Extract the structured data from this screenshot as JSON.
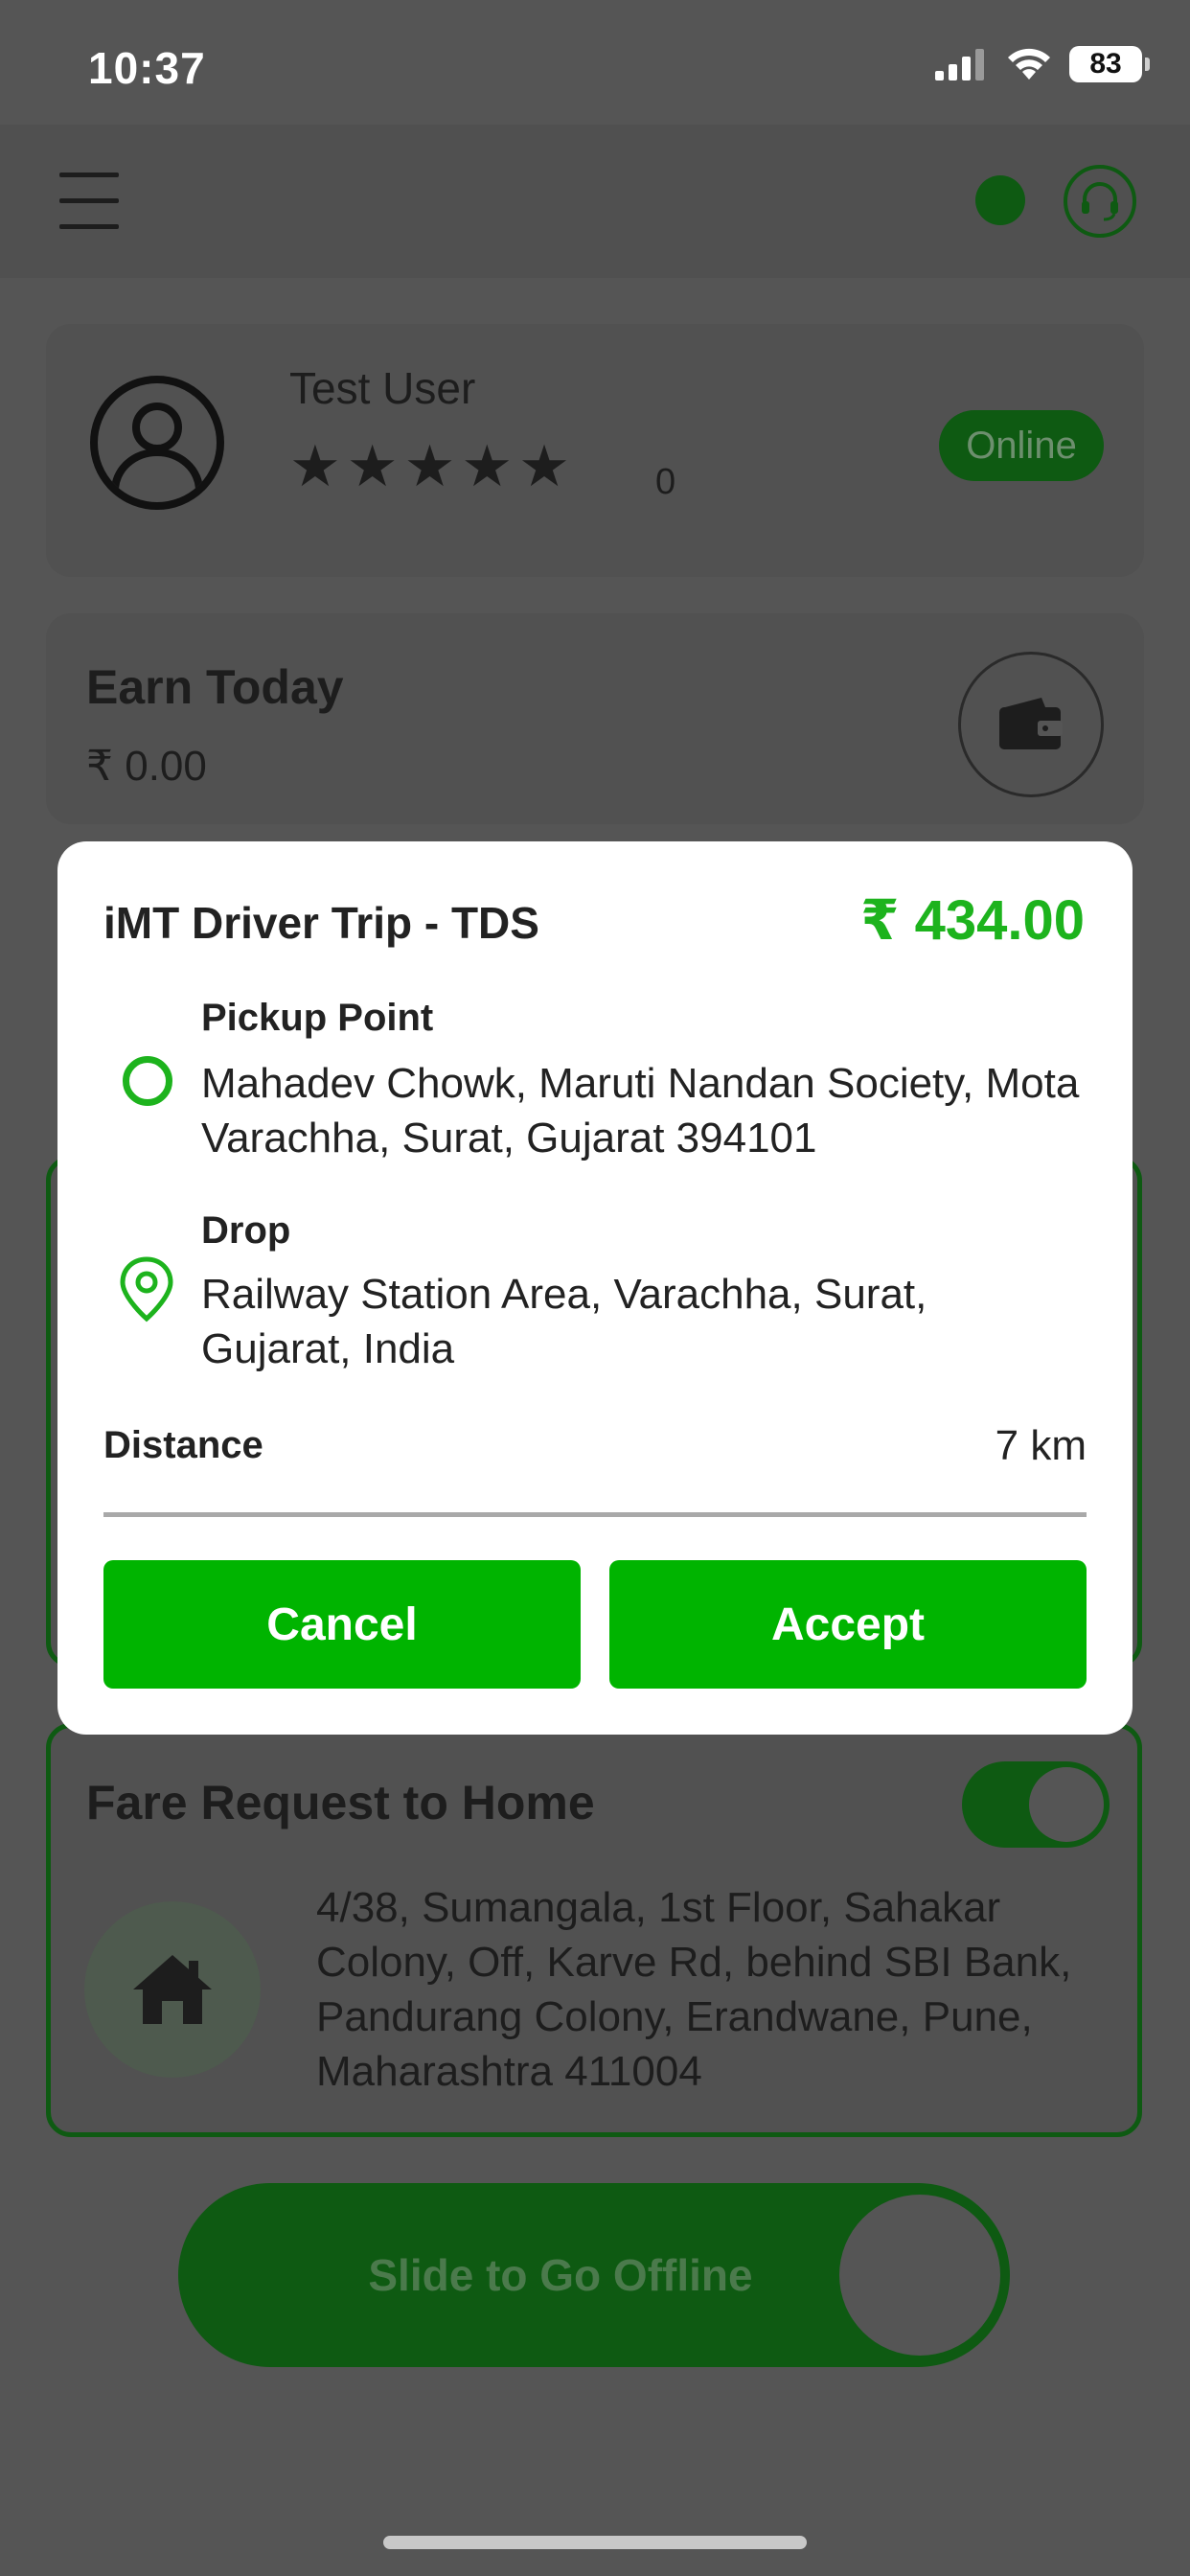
{
  "status_bar": {
    "time": "10:37",
    "battery": "83"
  },
  "header": {
    "menu_icon": "hamburger-menu-icon",
    "status_dot_color": "#0e5a12",
    "support_icon": "headset-icon"
  },
  "profile": {
    "name": "Test User",
    "stars": "★★★★★",
    "rating_count": "0",
    "status_badge": "Online"
  },
  "earnings": {
    "title": "Earn Today",
    "amount": "₹ 0.00",
    "wallet_icon": "wallet-icon"
  },
  "fare_request": {
    "title": "Fare Request to Home",
    "toggle_on": true,
    "address": "4/38, Sumangala, 1st Floor, Sahakar Colony, Off, Karve Rd, behind SBI Bank, Pandurang Colony, Erandwane, Pune, Maharashtra 411004",
    "home_icon": "home-icon"
  },
  "slider": {
    "label": "Slide to Go Offline"
  },
  "trip_modal": {
    "title": "iMT Driver Trip - TDS",
    "price": "₹ 434.00",
    "pickup_label": "Pickup Point",
    "pickup_address": "Mahadev Chowk, Maruti Nandan Society, Mota Varachha, Surat, Gujarat 394101",
    "drop_label": "Drop",
    "drop_address": "Railway Station Area, Varachha, Surat, Gujarat, India",
    "distance_label": "Distance",
    "distance_value": "7 km",
    "cancel_label": "Cancel",
    "accept_label": "Accept"
  },
  "colors": {
    "accent_green": "#00b400",
    "price_green": "#1db31d",
    "dark_green": "#0e5a12",
    "overlay_bg": "#555555"
  }
}
